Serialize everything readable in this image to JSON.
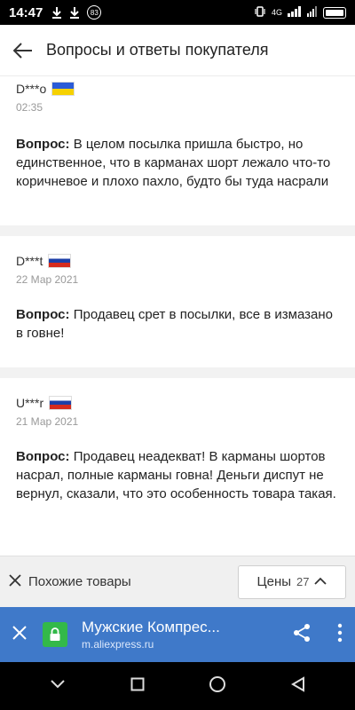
{
  "status_bar": {
    "time": "14:47",
    "notification_count": "83",
    "network": "4G"
  },
  "header": {
    "title": "Вопросы и ответы покупателя"
  },
  "questions": [
    {
      "user": "D***o",
      "flag": "ua-flag",
      "date": "02:35",
      "label": "Вопрос:",
      "text": "В целом посылка пришла быстро, но единственное, что в карманах шорт лежало что-то коричневое и плохо пахло, будто бы туда насрали"
    },
    {
      "user": "D***t",
      "flag": "ru-flag",
      "date": "22 Мар 2021",
      "label": "Вопрос:",
      "text": "Продавец срет в посылки, все в измазано в говне!"
    },
    {
      "user": "U***r",
      "flag": "ru-flag",
      "date": "21 Мар 2021",
      "label": "Вопрос:",
      "text": "Продавец неадекват! В карманы шортов насрал, полные карманы говна! Деньги диспут не вернул, сказали, что это особенность товара такая."
    }
  ],
  "similar_bar": {
    "label": "Похожие товары",
    "price_label": "Цены",
    "price_count": "27"
  },
  "browser_bar": {
    "title": "Мужские Компрес...",
    "url": "m.aliexpress.ru"
  },
  "colors": {
    "browser_bar": "#3f79c9",
    "lock_green": "#33b949",
    "page_bg": "#f2f2f2"
  }
}
